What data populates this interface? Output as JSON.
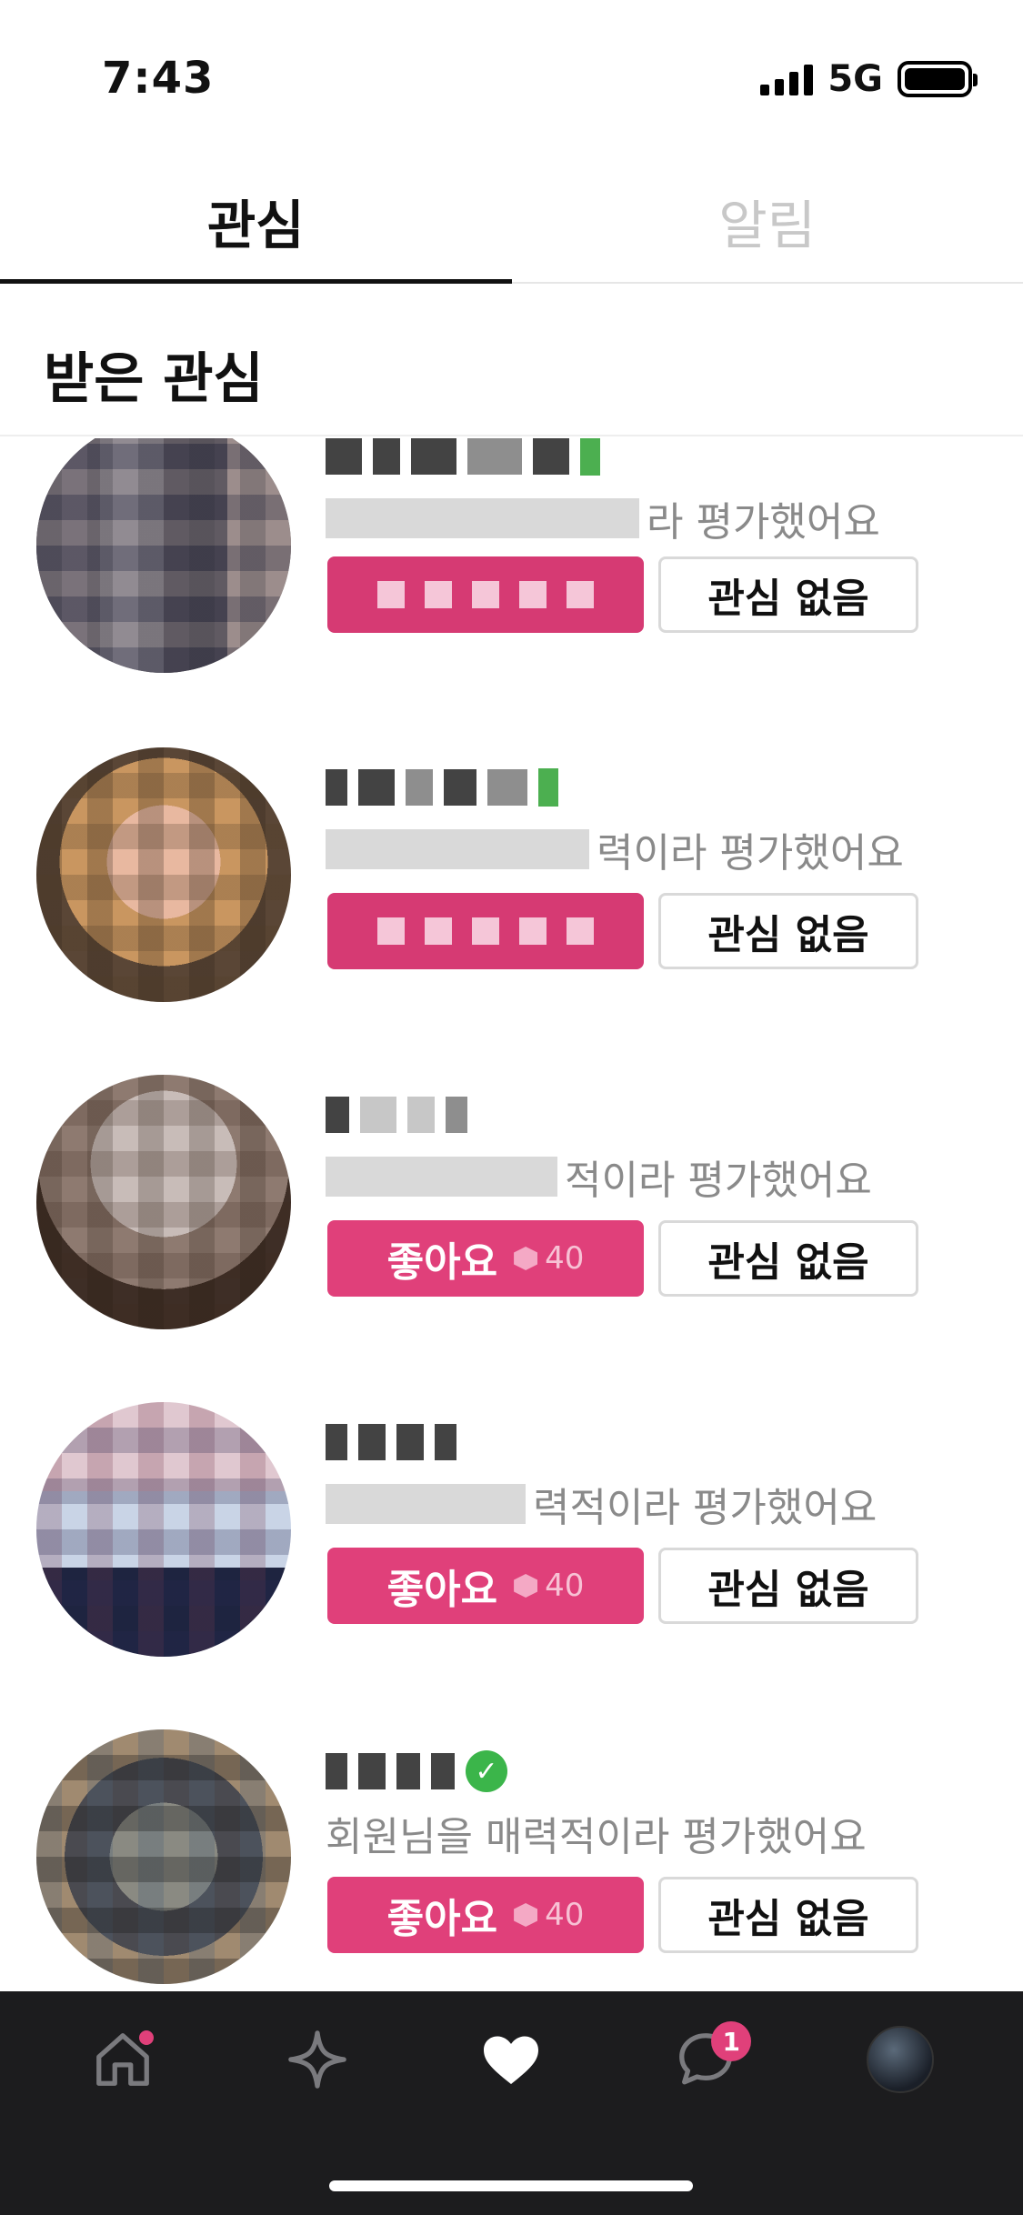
{
  "status_bar": {
    "time": "7:43",
    "network": "5G"
  },
  "tabs": [
    {
      "label": "관심",
      "active": true
    },
    {
      "label": "알림",
      "active": false
    }
  ],
  "section": {
    "title": "받은 관심"
  },
  "items": [
    {
      "desc_suffix": "라 평가했어요",
      "like_masked": true,
      "no_label": "관심 없음"
    },
    {
      "desc_suffix": "력이라 평가했어요",
      "like_masked": true,
      "no_label": "관심 없음"
    },
    {
      "desc_suffix": "적이라 평가했어요",
      "like_label": "좋아요",
      "like_cost": "40",
      "no_label": "관심 없음"
    },
    {
      "desc_suffix": "력적이라 평가했어요",
      "like_label": "좋아요",
      "like_cost": "40",
      "no_label": "관심 없음"
    },
    {
      "desc_suffix": "회원님을 매력적이라 평가했어요",
      "like_label": "좋아요",
      "like_cost": "40",
      "no_label": "관심 없음"
    }
  ],
  "bottom_nav": {
    "items": [
      {
        "icon": "home-icon",
        "has_dot": true
      },
      {
        "icon": "sparkle-icon"
      },
      {
        "icon": "heart-icon",
        "active": true
      },
      {
        "icon": "chat-icon",
        "badge": "1"
      },
      {
        "icon": "profile-avatar"
      }
    ]
  },
  "colors": {
    "accent": "#e0407a",
    "nav_bg": "#1c1c1e",
    "verified": "#3bb54a"
  }
}
